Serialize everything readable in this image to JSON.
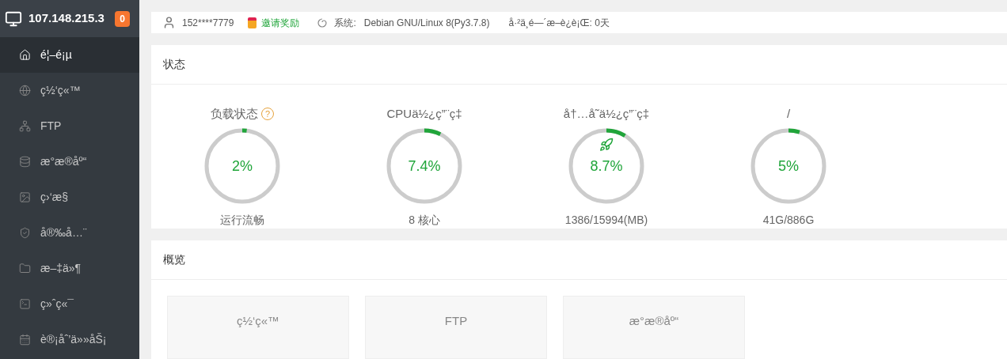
{
  "sidebar": {
    "server": "107.148.215.3",
    "badge": "0",
    "items": [
      {
        "label": "é¦–é¡µ",
        "selected": true
      },
      {
        "label": "ç½‘ç«™",
        "selected": false
      },
      {
        "label": "FTP",
        "selected": false
      },
      {
        "label": "æ°æ®åº“",
        "selected": false
      },
      {
        "label": "ç›‘æ§",
        "selected": false
      },
      {
        "label": "å®‰å…¨",
        "selected": false
      },
      {
        "label": "æ–‡ä»¶",
        "selected": false
      },
      {
        "label": "ç»ˆç«¯",
        "selected": false
      },
      {
        "label": "è®¡åˆ’ä»»åŠ¡",
        "selected": false
      }
    ]
  },
  "topbar": {
    "user": "152****7779",
    "invite": "邀请奖励",
    "system_label": "系统:",
    "system": "Debian GNU/Linux 8(Py3.7.8)",
    "uptime": "å·²ä¸é—´æ–­è¿è¡Œ: 0天"
  },
  "status": {
    "title": "状态",
    "gauges": [
      {
        "title": "负载状态",
        "help": "?",
        "value": "2%",
        "caption": "运行流畅",
        "rocket": false
      },
      {
        "title": "CPUä½¿ç”¨ç‡",
        "value": "7.4%",
        "caption": "8 核心",
        "rocket": false
      },
      {
        "title": "å†…å˜ä½¿ç”¨ç‡",
        "value": "8.7%",
        "caption": "1386/15994(MB)",
        "rocket": true
      },
      {
        "title": "/",
        "value": "5%",
        "caption": "41G/886G",
        "rocket": false
      }
    ]
  },
  "overview": {
    "title": "概览",
    "cards": [
      "ç½‘ç«™",
      "FTP",
      "æ°æ®åº“"
    ]
  }
}
